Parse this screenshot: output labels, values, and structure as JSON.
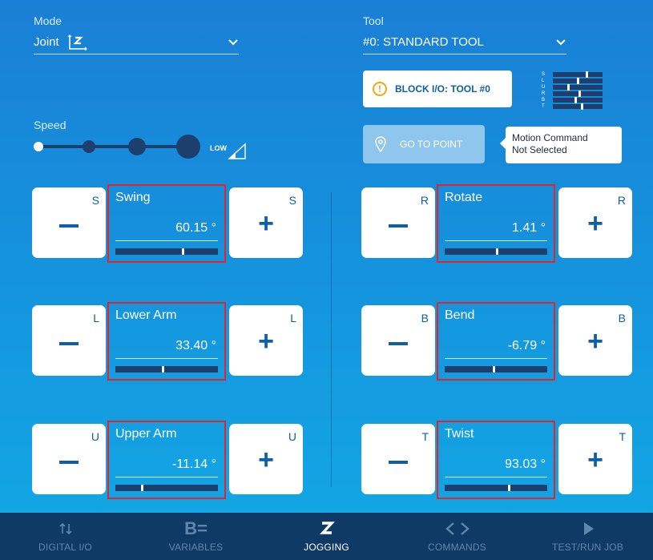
{
  "mode": {
    "label": "Mode",
    "value": "Joint"
  },
  "tool": {
    "label": "Tool",
    "value": "#0: STANDARD TOOL"
  },
  "speed": {
    "label": "Speed",
    "level_text": "LOW",
    "selected_index": 0
  },
  "block_io": {
    "label": "BLOCK I/O: TOOL #0"
  },
  "meter": {
    "letters": [
      "S",
      "L",
      "U",
      "R",
      "B",
      "T"
    ],
    "fractions": [
      0.7,
      0.5,
      0.3,
      0.55,
      0.45,
      0.6
    ]
  },
  "go_to_point": {
    "label": "GO TO POINT"
  },
  "tooltip": {
    "line1": "Motion Command",
    "line2": "Not Selected"
  },
  "axes": [
    {
      "id": "S",
      "name": "Swing",
      "value": "60.15 °",
      "fraction": 0.65
    },
    {
      "id": "L",
      "name": "Lower Arm",
      "value": "33.40 °",
      "fraction": 0.45
    },
    {
      "id": "U",
      "name": "Upper Arm",
      "value": "-11.14 °",
      "fraction": 0.25
    },
    {
      "id": "R",
      "name": "Rotate",
      "value": "1.41 °",
      "fraction": 0.5
    },
    {
      "id": "B",
      "name": "Bend",
      "value": "-6.79 °",
      "fraction": 0.47
    },
    {
      "id": "T",
      "name": "Twist",
      "value": "93.03 °",
      "fraction": 0.62
    }
  ],
  "jog_signs": {
    "minus": "−",
    "plus": "+"
  },
  "nav": [
    {
      "label": "DIGITAL I/O",
      "icon": "digital-io-icon",
      "active": false
    },
    {
      "label": "VARIABLES",
      "icon": "variables-icon",
      "active": false
    },
    {
      "label": "JOGGING",
      "icon": "jogging-icon",
      "active": true
    },
    {
      "label": "COMMANDS",
      "icon": "commands-icon",
      "active": false
    },
    {
      "label": "TEST/RUN JOB",
      "icon": "play-icon",
      "active": false
    }
  ],
  "colors": {
    "accent": "#0d5fa8",
    "highlight_border": "#e0262b",
    "warning": "#f3a712",
    "nav_bg": "#103a66"
  }
}
